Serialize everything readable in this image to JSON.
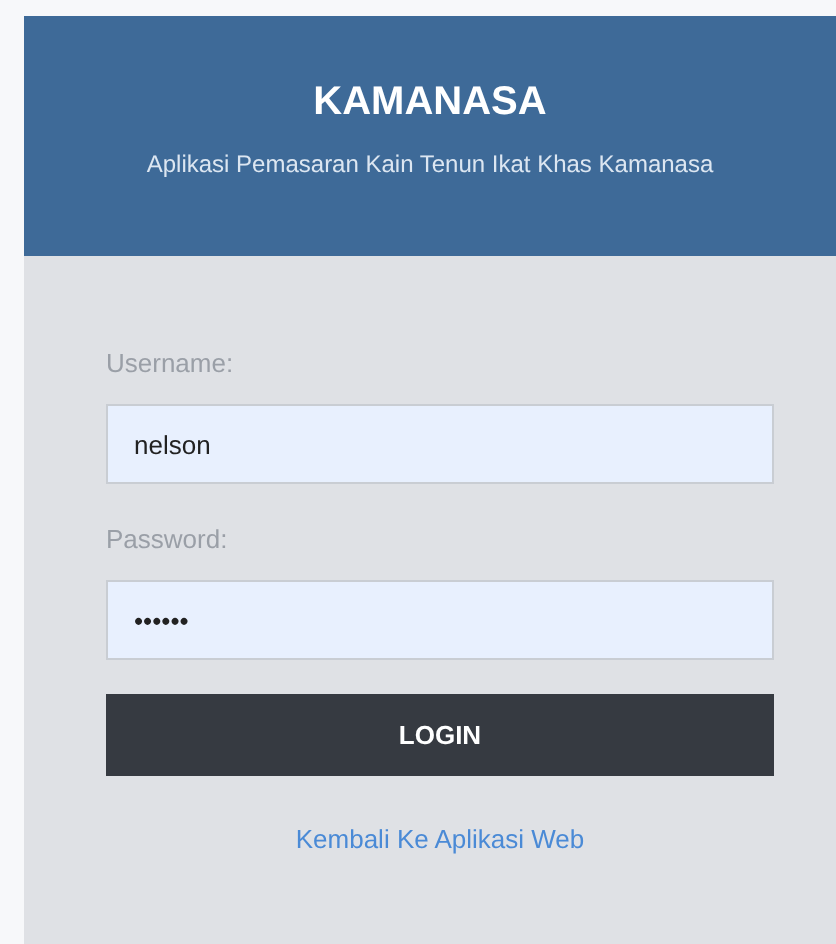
{
  "header": {
    "title": "KAMANASA",
    "subtitle": "Aplikasi Pemasaran Kain Tenun Ikat Khas Kamanasa"
  },
  "fields": [
    {
      "label": "Username:",
      "value": "nelson"
    },
    {
      "label": "Password:",
      "value": "••••••"
    }
  ],
  "button": "LOGIN",
  "link": "Kembali Ke Aplikasi Web"
}
